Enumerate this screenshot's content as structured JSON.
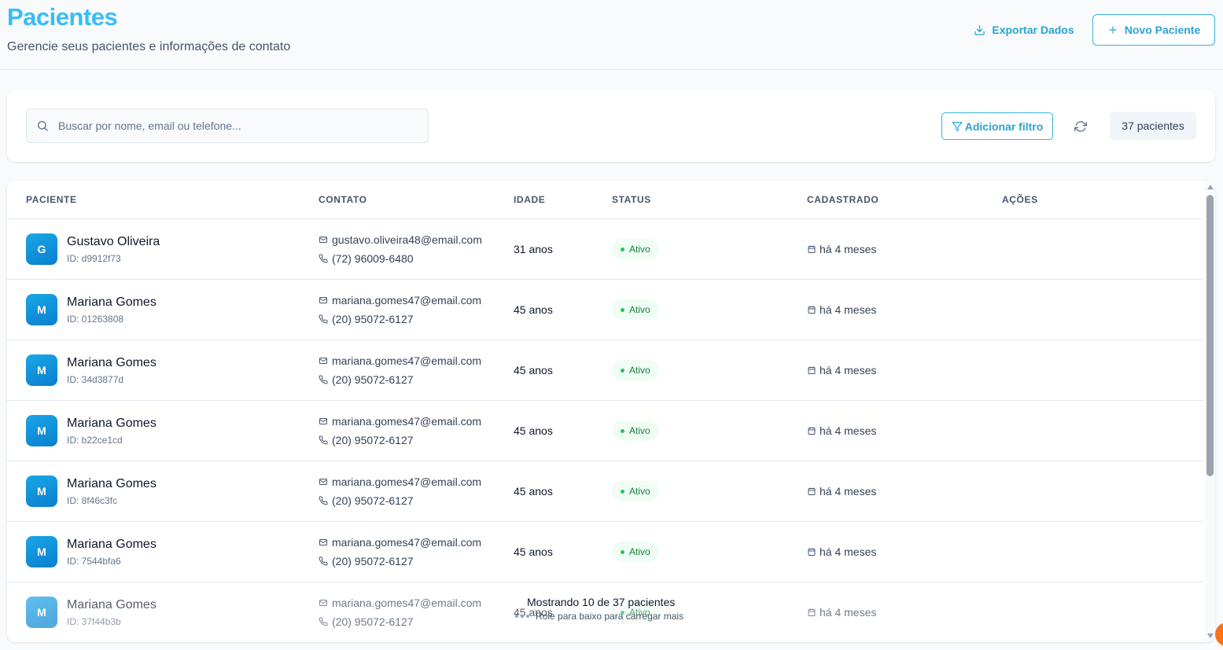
{
  "header": {
    "title": "Pacientes",
    "subtitle": "Gerencie seus pacientes e informações de contato",
    "export_label": "Exportar Dados",
    "new_label": "Novo Paciente"
  },
  "filters": {
    "search_placeholder": "Buscar por nome, email ou telefone...",
    "search_value": "",
    "add_filter_label": "Adicionar filtro",
    "count_label": "37 pacientes"
  },
  "table": {
    "columns": [
      "PACIENTE",
      "CONTATO",
      "IDADE",
      "STATUS",
      "CADASTRADO",
      "AÇÕES"
    ],
    "rows": [
      {
        "initial": "G",
        "name": "Gustavo Oliveira",
        "id": "ID: d9912f73",
        "email": "gustavo.oliveira48@email.com",
        "phone": "(72) 96009-6480",
        "age": "31 anos",
        "status": "Ativo",
        "registered": "há 4 meses"
      },
      {
        "initial": "M",
        "name": "Mariana Gomes",
        "id": "ID: 01263808",
        "email": "mariana.gomes47@email.com",
        "phone": "(20) 95072-6127",
        "age": "45 anos",
        "status": "Ativo",
        "registered": "há 4 meses"
      },
      {
        "initial": "M",
        "name": "Mariana Gomes",
        "id": "ID: 34d3877d",
        "email": "mariana.gomes47@email.com",
        "phone": "(20) 95072-6127",
        "age": "45 anos",
        "status": "Ativo",
        "registered": "há 4 meses"
      },
      {
        "initial": "M",
        "name": "Mariana Gomes",
        "id": "ID: b22ce1cd",
        "email": "mariana.gomes47@email.com",
        "phone": "(20) 95072-6127",
        "age": "45 anos",
        "status": "Ativo",
        "registered": "há 4 meses"
      },
      {
        "initial": "M",
        "name": "Mariana Gomes",
        "id": "ID: 8f46c3fc",
        "email": "mariana.gomes47@email.com",
        "phone": "(20) 95072-6127",
        "age": "45 anos",
        "status": "Ativo",
        "registered": "há 4 meses"
      },
      {
        "initial": "M",
        "name": "Mariana Gomes",
        "id": "ID: 7544bfa6",
        "email": "mariana.gomes47@email.com",
        "phone": "(20) 95072-6127",
        "age": "45 anos",
        "status": "Ativo",
        "registered": "há 4 meses"
      },
      {
        "initial": "M",
        "name": "Mariana Gomes",
        "id": "ID: 37f44b3b",
        "email": "mariana.gomes47@email.com",
        "phone": "(20) 95072-6127",
        "age": "45 anos",
        "status": "Ativo",
        "registered": "há 4 meses"
      }
    ],
    "showing_text": "Mostrando 10 de 37 pacientes",
    "scroll_hint": "Role para baixo para carregar mais"
  },
  "icons": {
    "export": "download-icon",
    "new": "plus-icon",
    "search": "search-icon",
    "filter": "filter-icon",
    "refresh": "refresh-icon",
    "email": "mail-icon",
    "phone": "phone-icon",
    "calendar": "calendar-icon"
  },
  "colors": {
    "accent": "#38bdf8",
    "status_active": "#22c55e",
    "avatar": "#0a8fdb"
  }
}
